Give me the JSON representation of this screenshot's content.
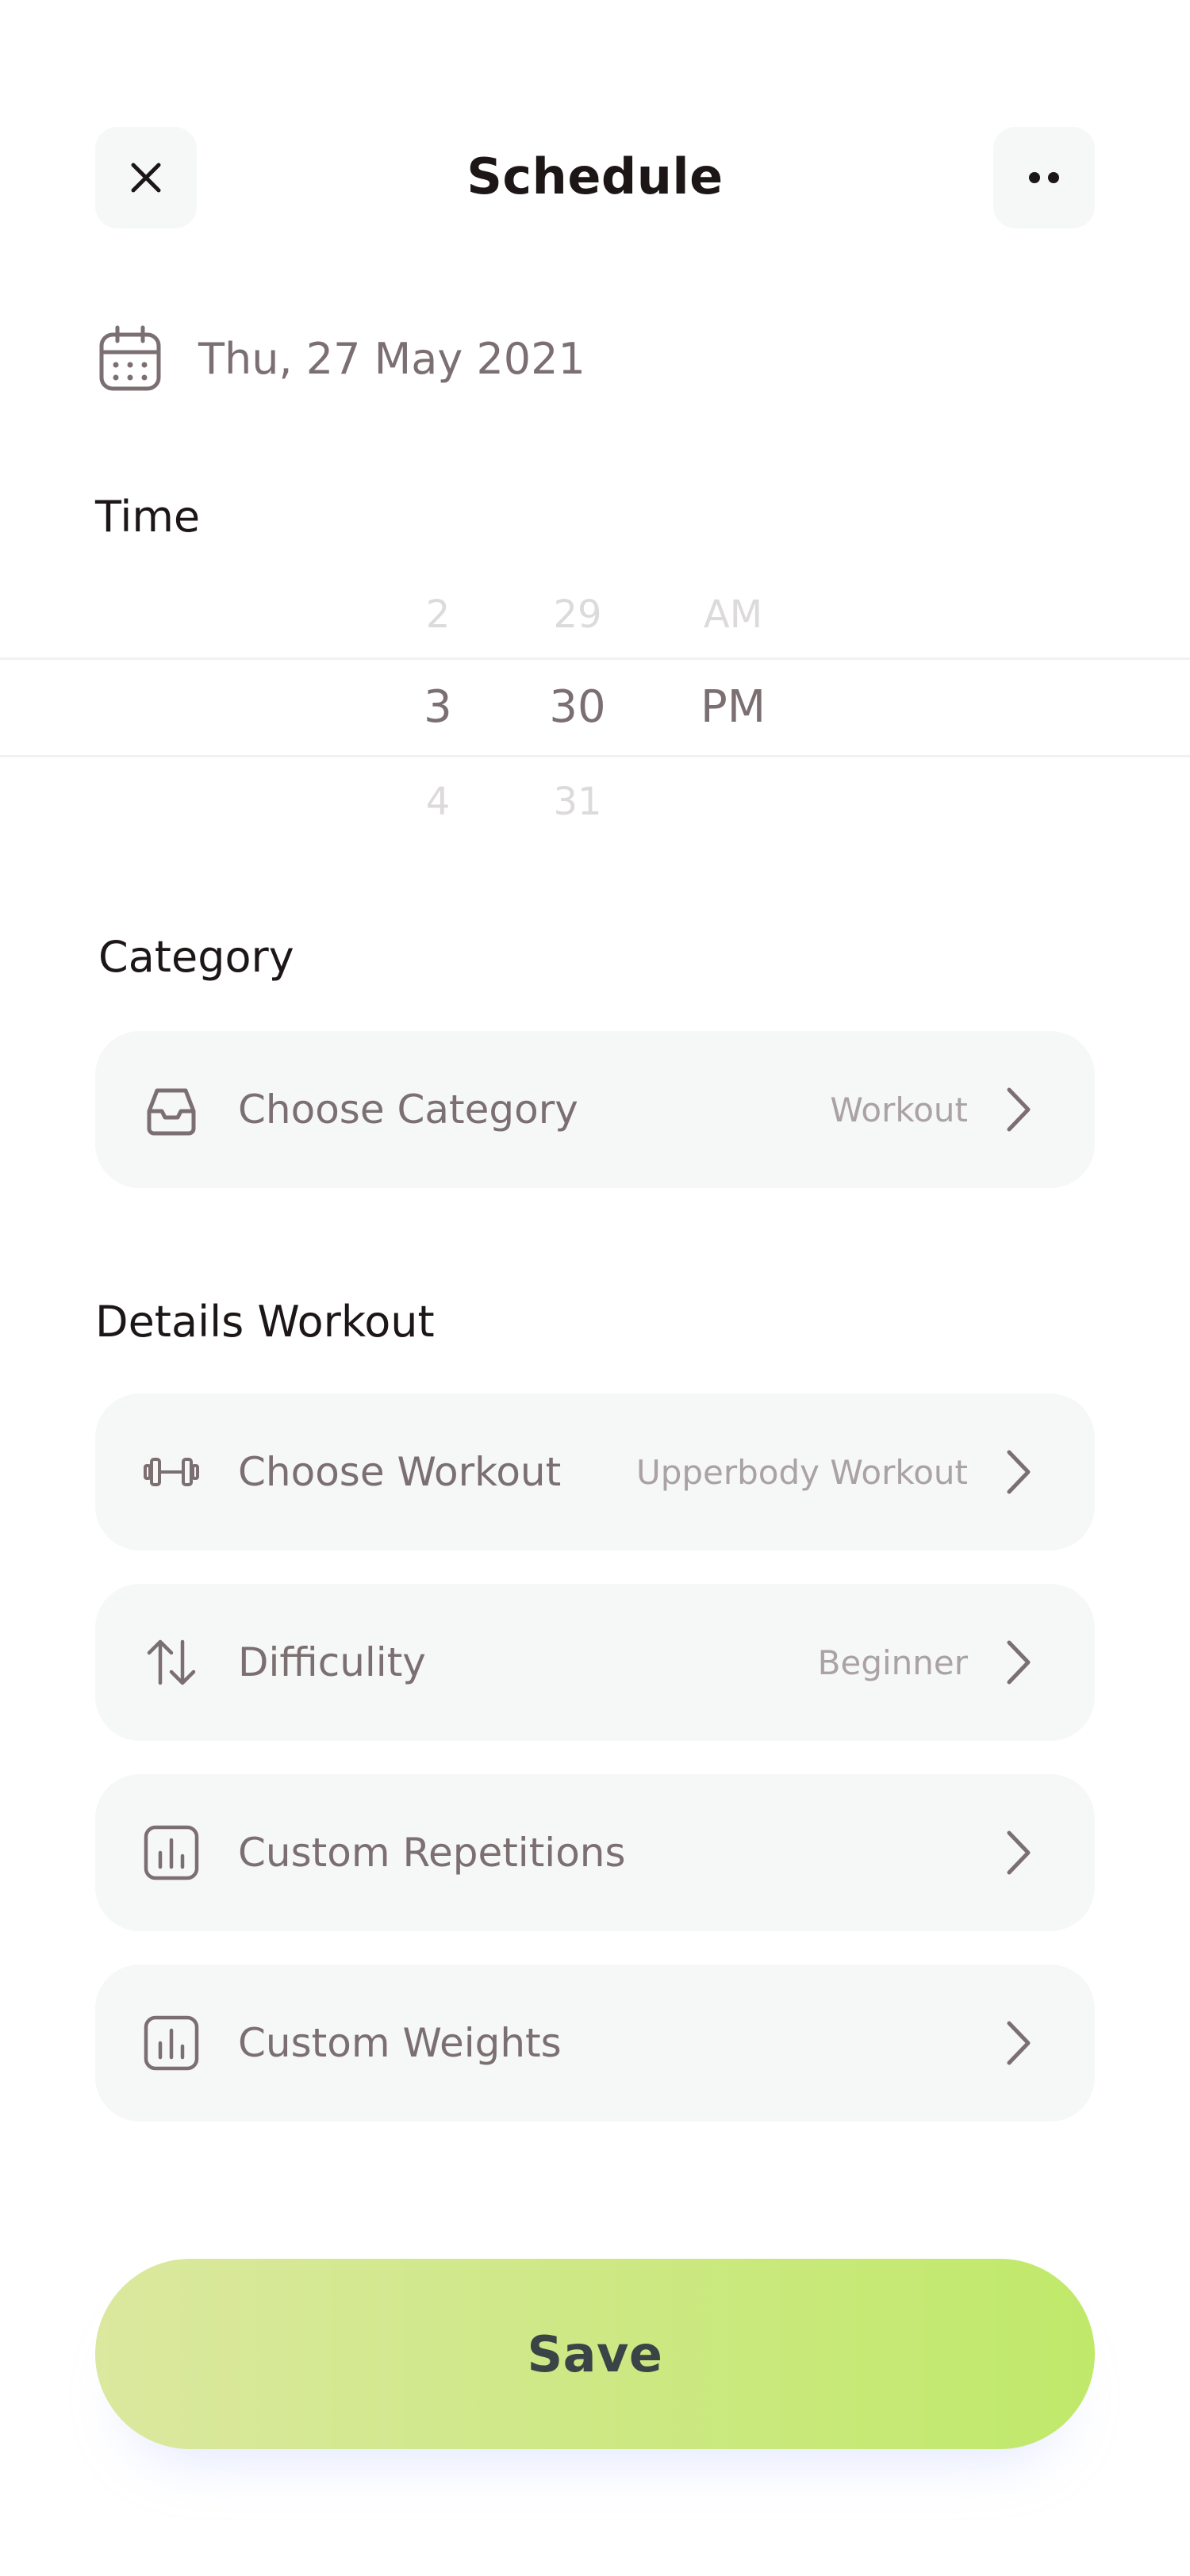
{
  "header": {
    "title": "Schedule",
    "close_icon": "close-icon",
    "more_icon": "more-icon"
  },
  "date": {
    "icon": "calendar-icon",
    "text": "Thu, 27 May 2021"
  },
  "time": {
    "label": "Time",
    "picker": {
      "hours": [
        "2",
        "3",
        "4"
      ],
      "minutes": [
        "29",
        "30",
        "31"
      ],
      "periods": [
        "AM",
        "PM"
      ],
      "selected": {
        "hour": "3",
        "minute": "30",
        "period": "PM"
      }
    }
  },
  "category": {
    "label": "Category",
    "row": {
      "icon": "inbox-icon",
      "label": "Choose Category",
      "value": "Workout"
    }
  },
  "details": {
    "label": "Details Workout",
    "rows": [
      {
        "icon": "dumbbell-icon",
        "label": "Choose Workout",
        "value": "Upperbody Workout"
      },
      {
        "icon": "swap-vertical-icon",
        "label": "Difficulity",
        "value": "Beginner"
      },
      {
        "icon": "bar-chart-icon",
        "label": "Custom Repetitions",
        "value": ""
      },
      {
        "icon": "bar-chart-icon",
        "label": "Custom Weights",
        "value": ""
      }
    ]
  },
  "save": {
    "label": "Save"
  },
  "colors": {
    "primary_text": "#1d1617",
    "secondary_text": "#7b6f72",
    "muted_text": "#aaa2a4",
    "row_background": "#f6f7f7",
    "save_gradient_start": "#dbe89f",
    "save_gradient_end": "#c0e96a"
  }
}
